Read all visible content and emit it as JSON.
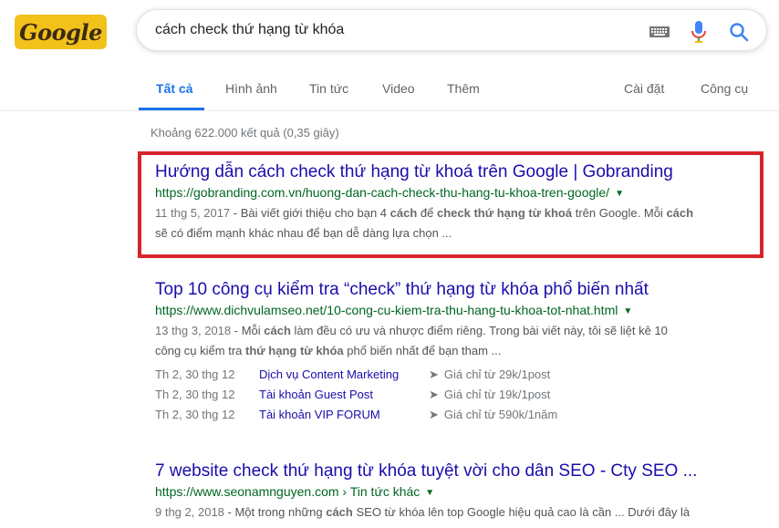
{
  "logo": {
    "text": "Google"
  },
  "search": {
    "query": "cách check thứ hạng từ khóa"
  },
  "tabs": [
    {
      "label": "Tất cả",
      "active": true
    },
    {
      "label": "Hình ảnh"
    },
    {
      "label": "Tin tức"
    },
    {
      "label": "Video"
    },
    {
      "label": "Thêm"
    },
    {
      "label": "Cài đặt"
    },
    {
      "label": "Công cụ"
    }
  ],
  "stats": "Khoảng 622.000 kết quả (0,35 giây)",
  "results": [
    {
      "title": "Hướng dẫn cách check thứ hạng từ khoá trên Google | Gobranding",
      "url": "https://gobranding.com.vn/huong-dan-cach-check-thu-hang-tu-khoa-tren-google/",
      "date": "11 thg 5, 2017",
      "snippet_line1": [
        " - Bài viết giới thiệu cho bạn 4 ",
        "cách",
        " để ",
        "check thứ hạng từ khoá",
        " trên Google. Mỗi ",
        "cách"
      ],
      "snippet_line2": "sẽ có điểm mạnh khác nhau để bạn dễ dàng lựa chọn ..."
    },
    {
      "title": "Top 10 công cụ kiểm tra “check” thứ hạng từ khóa phổ biến nhất",
      "url": "https://www.dichvulamseo.net/10-cong-cu-kiem-tra-thu-hang-tu-khoa-tot-nhat.html",
      "date": "13 thg 3, 2018",
      "snippet_line1": [
        " - Mỗi ",
        "cách",
        " làm đều có ưu và nhược điểm riêng. Trong bài viết này, tôi sẽ liệt kê 10"
      ],
      "snippet_line2": [
        "công cụ kiểm tra ",
        "thứ hạng từ khóa",
        " phổ biến nhất để bạn tham ..."
      ],
      "deals": [
        {
          "date": "Th 2, 30 thg 12",
          "link": "Dịch vụ Content Marketing",
          "price": "Giá chỉ từ 29k/1post"
        },
        {
          "date": "Th 2, 30 thg 12",
          "link": "Tài khoản Guest Post",
          "price": "Giá chỉ từ 19k/1post"
        },
        {
          "date": "Th 2, 30 thg 12",
          "link": "Tài khoản VIP FORUM",
          "price": "Giá chỉ từ 590k/1năm"
        }
      ]
    },
    {
      "title": "7 website check thứ hạng từ khóa tuyệt vời cho dân SEO - Cty SEO ...",
      "url": "https://www.seonamnguyen.com › Tin tức khác",
      "date": "9 thg 2, 2018",
      "snippet_line1": [
        " - Một trong những ",
        "cách",
        " SEO từ khóa lên top Google hiệu quả cao là cần ... Dưới đây là"
      ]
    }
  ],
  "colors": {
    "link": "#1a0dab",
    "url": "#006621",
    "accent": "#1a73e8",
    "highlight": "#d9242c"
  }
}
